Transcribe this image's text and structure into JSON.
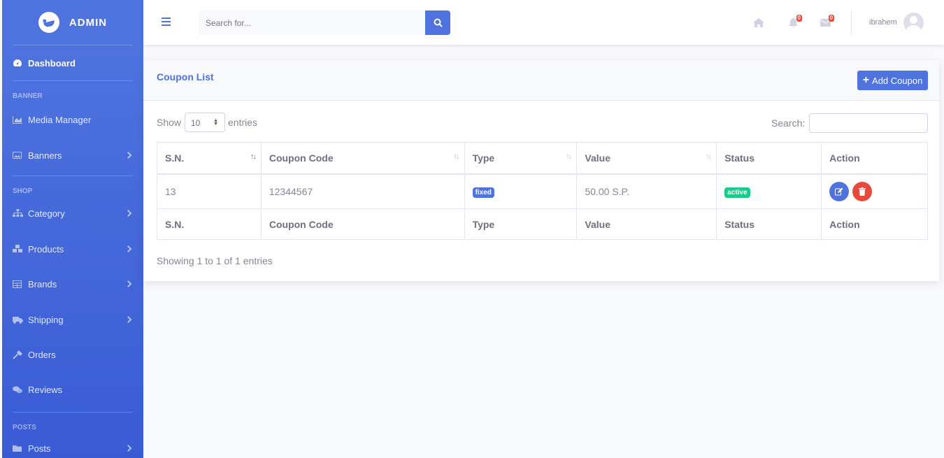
{
  "brand": {
    "name": "ADMIN"
  },
  "sidebar": {
    "dashboard": "Dashboard",
    "headings": [
      "BANNER",
      "SHOP",
      "POSTS"
    ],
    "items": [
      {
        "label": "Media Manager",
        "icon": "chart-area-icon"
      },
      {
        "label": "Banners",
        "icon": "image-icon"
      },
      {
        "label": "Category",
        "icon": "sitemap-icon"
      },
      {
        "label": "Products",
        "icon": "cubes-icon"
      },
      {
        "label": "Brands",
        "icon": "table-icon"
      },
      {
        "label": "Shipping",
        "icon": "truck-icon"
      },
      {
        "label": "Orders",
        "icon": "hammer-icon"
      },
      {
        "label": "Reviews",
        "icon": "comments-icon"
      },
      {
        "label": "Posts",
        "icon": "folder-icon"
      }
    ]
  },
  "topbar": {
    "search_placeholder": "Search for...",
    "notifications_count": "0",
    "messages_count": "0",
    "username": "ibrahem"
  },
  "card": {
    "title": "Coupon List",
    "add_button": "Add Coupon"
  },
  "datatable": {
    "show_label": "Show",
    "length": "10",
    "entries_label": "entries",
    "search_label": "Search:",
    "columns": [
      "S.N.",
      "Coupon Code",
      "Type",
      "Value",
      "Status",
      "Action"
    ],
    "rows": [
      {
        "sn": "13",
        "code": "12344567",
        "type": "fixed",
        "value": "50.00 S.P.",
        "status": "active"
      }
    ],
    "info": "Showing 1 to 1 of 1 entries"
  },
  "colors": {
    "primary": "#4e73df",
    "success": "#1cc88a",
    "danger": "#e74a3b"
  }
}
